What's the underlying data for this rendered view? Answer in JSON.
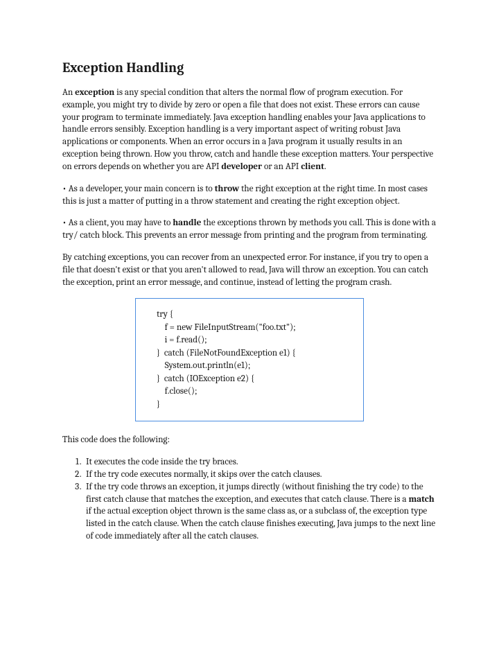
{
  "title": "Exception Handling",
  "p1_a": "An ",
  "p1_b": "exception",
  "p1_c": " is any special condition that alters the normal flow of program execution. For example, you might try to divide by zero or open a file that does not exist. These errors can cause your program to terminate immediately. Java exception handling enables your Java applications to handle errors sensibly. Exception handling is a very important aspect of writing robust Java applications or components. When an error occurs in a Java program it usually results in an exception being thrown. How you throw, catch and handle these exception matters. Your perspective on errors depends on whether you are API ",
  "p1_d": "developer",
  "p1_e": " or an API ",
  "p1_f": "client",
  "p1_g": ".",
  "p2_a": "• As a developer, your main concern is to ",
  "p2_b": "throw",
  "p2_c": " the right exception at the right time. In most cases this is just a matter of putting in a throw statement and creating the right exception object.",
  "p3_a": "• As a client, you may have to ",
  "p3_b": "handle",
  "p3_c": " the exceptions thrown by methods you call. This is done with a try/ catch block. This prevents an error message from printing and the program from terminating.",
  "p4": "By catching exceptions, you can recover from an unexpected error. For instance, if you try to open a file that doesn't exist or that you aren't allowed to read, Java will throw an exception. You can catch the exception, print an error message, and continue, instead of letting the program crash.",
  "code": "try {\n    f = new FileInputStream(\"foo.txt\");\n    i = f.read();\n}  catch (FileNotFoundException e1) {\n    System.out.println(e1);\n}  catch (IOException e2) {\n    f.close();\n}",
  "p5": "This code does the following:",
  "li1": "It executes the code inside the try braces.",
  "li2": "If the try code executes normally, it skips over the  catch clauses.",
  "li3_a": "If the try code throws an exception, it jumps directly (without finishing the try code) to the first catch clause that matches the exception, and executes that catch clause. There is a ",
  "li3_b": "match",
  "li3_c": " if the actual exception object thrown is the same class as, or a subclass of, the exception type listed in the catch clause. When the catch clause finishes executing, Java jumps to the next line of code immediately after all the catch clauses."
}
